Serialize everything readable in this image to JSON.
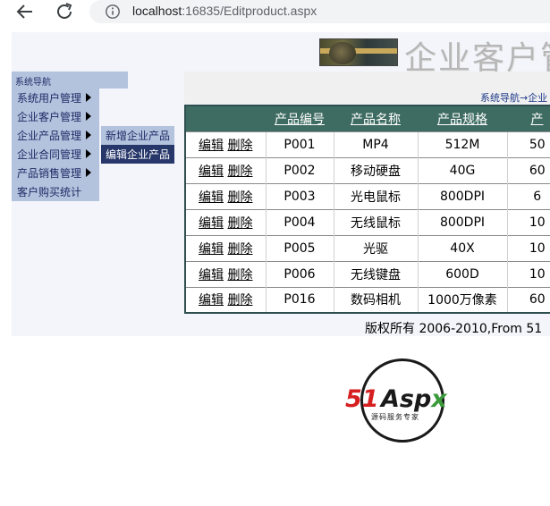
{
  "browser": {
    "url_host": "localhost",
    "url_rest": ":16835/Editproduct.aspx"
  },
  "banner": {
    "title": "企业客户管"
  },
  "sidebar": {
    "header": "系统导航",
    "items": [
      {
        "label": "系统用户管理",
        "has_arrow": true
      },
      {
        "label": "企业客户管理",
        "has_arrow": true
      },
      {
        "label": "企业产品管理",
        "has_arrow": true
      },
      {
        "label": "企业合同管理",
        "has_arrow": true
      },
      {
        "label": "产品销售管理",
        "has_arrow": true
      },
      {
        "label": "客户购买统计",
        "has_arrow": false
      }
    ],
    "submenu": [
      {
        "label": "新增企业产品",
        "active": false
      },
      {
        "label": "编辑企业产品",
        "active": true
      }
    ]
  },
  "breadcrumb": "系统导航→企业",
  "table": {
    "columns": [
      "",
      "产品编号",
      "产品名称",
      "产品规格",
      "产"
    ],
    "edit_label": "编辑",
    "delete_label": "删除",
    "rows": [
      {
        "id": "P001",
        "name": "MP4",
        "spec": "512M",
        "extra": "50"
      },
      {
        "id": "P002",
        "name": "移动硬盘",
        "spec": "40G",
        "extra": "60"
      },
      {
        "id": "P003",
        "name": "光电鼠标",
        "spec": "800DPI",
        "extra": "6"
      },
      {
        "id": "P004",
        "name": "无线鼠标",
        "spec": "800DPI",
        "extra": "10"
      },
      {
        "id": "P005",
        "name": "光驱",
        "spec": "40X",
        "extra": "10"
      },
      {
        "id": "P006",
        "name": "无线键盘",
        "spec": "600D",
        "extra": "10"
      },
      {
        "id": "P016",
        "name": "数码相机",
        "spec": "1000万像素",
        "extra": "60"
      }
    ]
  },
  "footer": "版权所有  2006-2010,From 51",
  "logo": {
    "brand_51": "51",
    "brand_asp": "Asp",
    "brand_x": "x",
    "tagline": "源码服务专家"
  },
  "colors": {
    "header_green": "#3e6c62",
    "menu_blue": "#b3c2dd",
    "menu_active": "#27376a",
    "logo_red": "#d62020"
  }
}
